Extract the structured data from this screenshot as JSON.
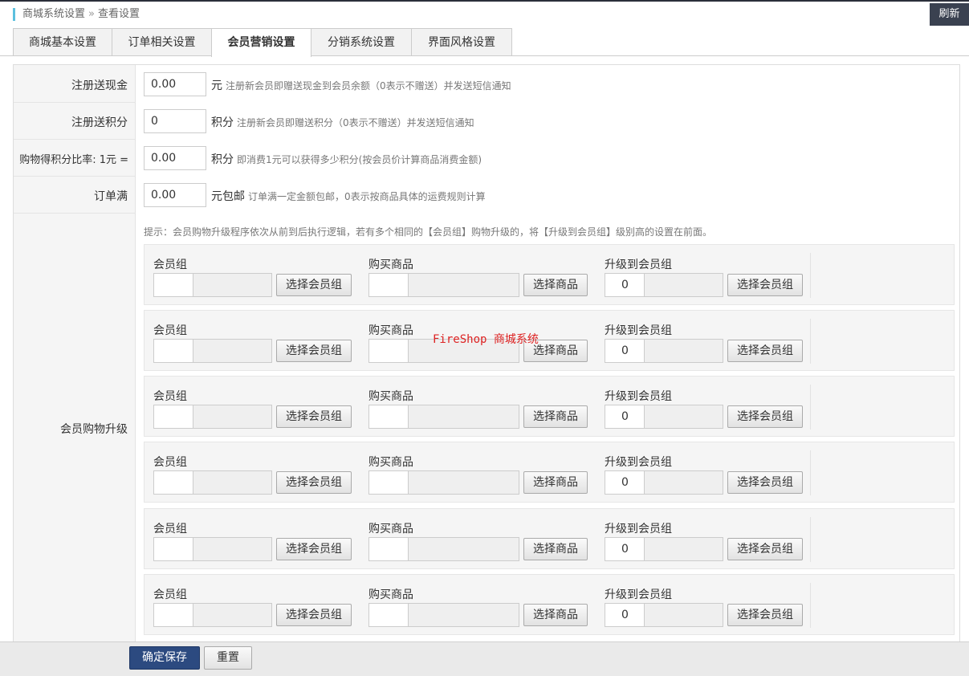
{
  "header": {
    "breadcrumb_parent": "商城系统设置",
    "breadcrumb_sep": "»",
    "breadcrumb_current": "查看设置",
    "refresh_label": "刷新"
  },
  "tabs": [
    {
      "label": "商城基本设置",
      "active": false
    },
    {
      "label": "订单相关设置",
      "active": false
    },
    {
      "label": "会员营销设置",
      "active": true
    },
    {
      "label": "分销系统设置",
      "active": false
    },
    {
      "label": "界面风格设置",
      "active": false
    }
  ],
  "form": {
    "register_cash": {
      "label": "注册送现金",
      "value": "0.00",
      "unit": "元",
      "hint": "注册新会员即赠送现金到会员余额（0表示不赠送）并发送短信通知"
    },
    "register_points": {
      "label": "注册送积分",
      "value": "0",
      "unit": "积分",
      "hint": "注册新会员即赠送积分（0表示不赠送）并发送短信通知"
    },
    "points_ratio": {
      "label": "购物得积分比率: 1元 =",
      "value": "0.00",
      "unit": "积分",
      "hint": "即消费1元可以获得多少积分(按会员价计算商品消费金额)"
    },
    "free_shipping": {
      "label": "订单满",
      "value": "0.00",
      "unit": "元包邮",
      "hint": "订单满一定金额包邮，0表示按商品具体的运费规则计算"
    },
    "upgrade": {
      "label": "会员购物升级",
      "tip": "提示：会员购物升级程序依次从前到后执行逻辑，若有多个相同的【会员组】购物升级的，将【升级到会员组】级别高的设置在前面。",
      "rows": [
        {
          "group_label": "会员组",
          "group_btn": "选择会员组",
          "product_label": "购买商品",
          "product_btn": "选择商品",
          "target_label": "升级到会员组",
          "target_value": "0",
          "target_btn": "选择会员组"
        },
        {
          "group_label": "会员组",
          "group_btn": "选择会员组",
          "product_label": "购买商品",
          "product_btn": "选择商品",
          "target_label": "升级到会员组",
          "target_value": "0",
          "target_btn": "选择会员组"
        },
        {
          "group_label": "会员组",
          "group_btn": "选择会员组",
          "product_label": "购买商品",
          "product_btn": "选择商品",
          "target_label": "升级到会员组",
          "target_value": "0",
          "target_btn": "选择会员组"
        },
        {
          "group_label": "会员组",
          "group_btn": "选择会员组",
          "product_label": "购买商品",
          "product_btn": "选择商品",
          "target_label": "升级到会员组",
          "target_value": "0",
          "target_btn": "选择会员组"
        },
        {
          "group_label": "会员组",
          "group_btn": "选择会员组",
          "product_label": "购买商品",
          "product_btn": "选择商品",
          "target_label": "升级到会员组",
          "target_value": "0",
          "target_btn": "选择会员组"
        },
        {
          "group_label": "会员组",
          "group_btn": "选择会员组",
          "product_label": "购买商品",
          "product_btn": "选择商品",
          "target_label": "升级到会员组",
          "target_value": "0",
          "target_btn": "选择会员组"
        }
      ]
    }
  },
  "watermark": "FireShop 商城系统",
  "footer": {
    "save_label": "确定保存",
    "reset_label": "重置"
  },
  "colors": {
    "accent": "#5bc0de",
    "primary_button": "#2c4a80",
    "watermark": "#dd2222",
    "top_bar": "#2b2f3a"
  }
}
